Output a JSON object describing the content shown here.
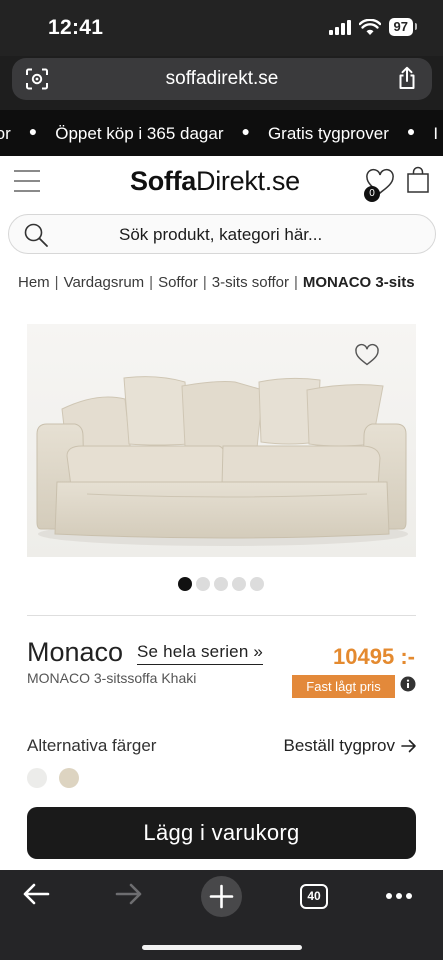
{
  "status": {
    "time": "12:41",
    "battery": "97"
  },
  "browser": {
    "url": "soffadirekt.se",
    "tabs_count": "40"
  },
  "promo": {
    "items": [
      "ror",
      "Öppet köp i 365 dagar",
      "Gratis tygprover",
      "I"
    ]
  },
  "header": {
    "logo_bold": "Soffa",
    "logo_rest": "Direkt.se",
    "wishlist_count": "0"
  },
  "search": {
    "placeholder": "Sök produkt, kategori här..."
  },
  "breadcrumb": {
    "items": [
      "Hem",
      "Vardagsrum",
      "Soffor",
      "3-sits soffor"
    ],
    "current": "MONACO 3-sits"
  },
  "product": {
    "name": "Monaco",
    "series_link": "Se hela serien »",
    "subtitle": "MONACO 3-sitssoffa Khaki",
    "price": "10495 :-",
    "price_tag": "Fast lågt pris",
    "image_count": 5,
    "active_image": 1
  },
  "colors": {
    "label": "Alternativa färger",
    "order_sample": "Beställ tygprov",
    "swatches": [
      "#ececea",
      "#ddd4c1"
    ]
  },
  "cart": {
    "button": "Lägg i varukorg"
  },
  "theme": {
    "accent": "#e48a2f",
    "dark": "#1a1a1a"
  }
}
